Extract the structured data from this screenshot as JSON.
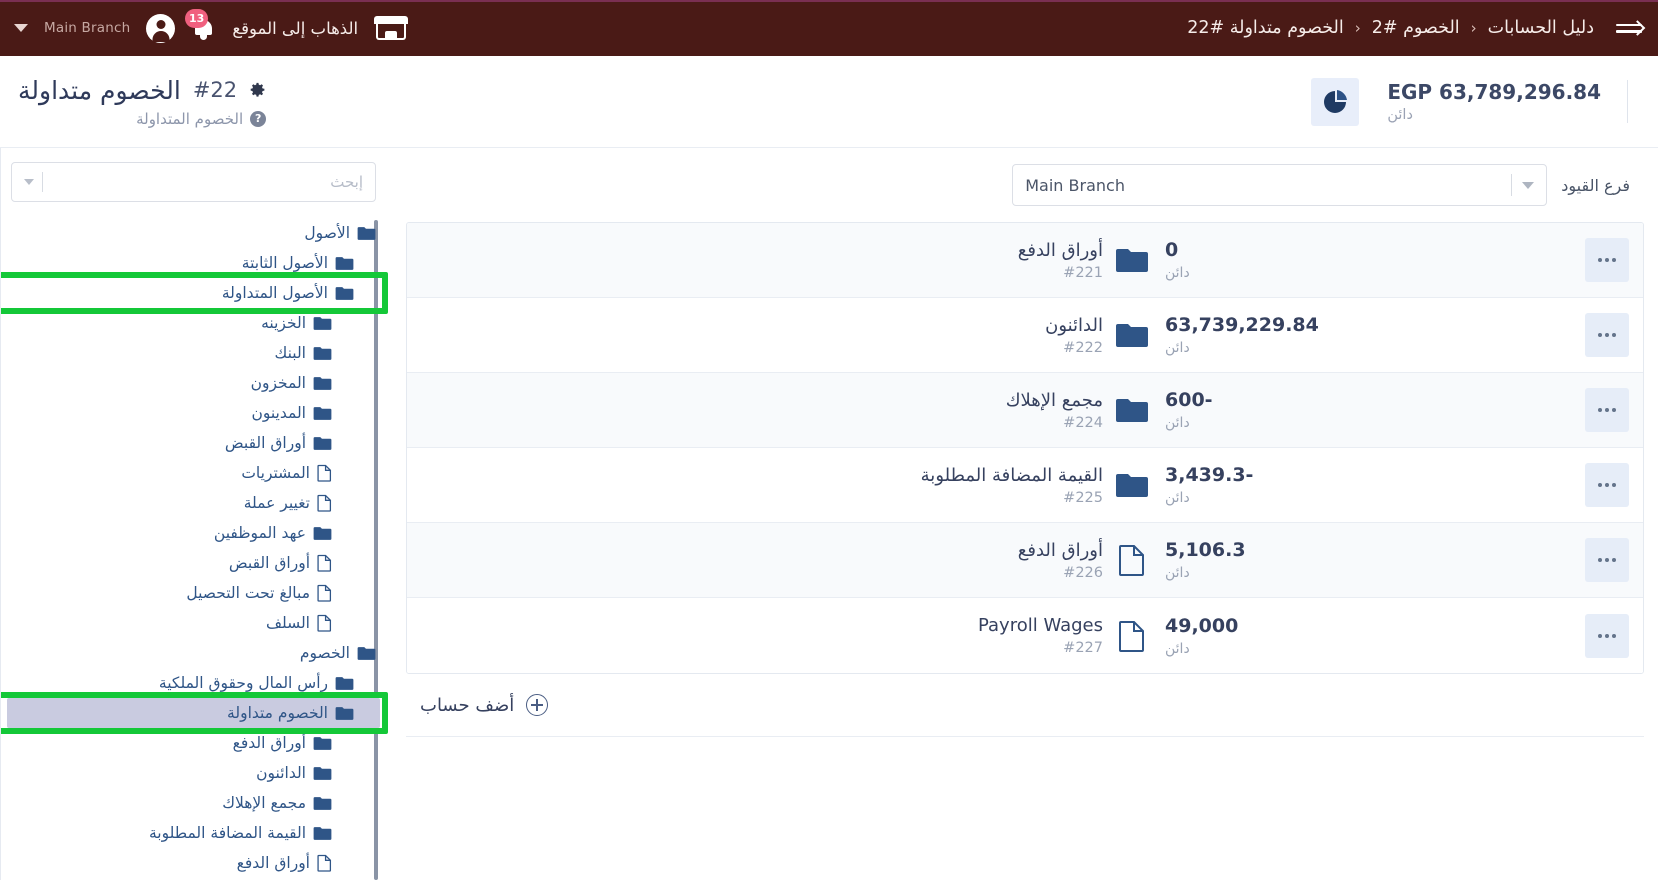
{
  "topbar": {
    "menu_icon": "hamburger-arrow-icon",
    "breadcrumb": [
      {
        "label": "دليل الحسابات"
      },
      {
        "label": "الخصوم #2"
      },
      {
        "label": "الخصوم متداولة #22"
      }
    ],
    "separator": "‹",
    "branch_label": "Main Branch",
    "branch_caret_icon": "chevron-down-icon",
    "avatar_icon": "user-avatar-icon",
    "bell_icon": "bell-icon",
    "notification_count": "13",
    "goto_site_label": "الذهاب إلى الموقع",
    "shop_icon": "storefront-icon"
  },
  "header": {
    "title": "الخصوم متداولة",
    "title_number": "#22",
    "gear_icon": "gear-icon",
    "subtitle": "الخصوم المتداولة",
    "help_icon": "help-circle-icon",
    "balance_icon": "pie-chart-icon",
    "balance_amount": "EGP 63,789,296.84",
    "balance_type": "دائن"
  },
  "filter": {
    "label": "فرع القيود",
    "selected_value": "Main Branch",
    "caret_icon": "chevron-down-icon"
  },
  "search": {
    "placeholder": "إبحث",
    "value": "",
    "caret_icon": "chevron-down-icon"
  },
  "accounts": [
    {
      "name": "أوراق الدفع",
      "code": "#221",
      "icon": "folder-icon",
      "amount": "0",
      "type": "دائن",
      "menu_icon": "ellipsis-icon"
    },
    {
      "name": "الدائنون",
      "code": "#222",
      "icon": "folder-icon",
      "amount": "63,739,229.84",
      "type": "دائن",
      "menu_icon": "ellipsis-icon"
    },
    {
      "name": "مجمع الإهلاك",
      "code": "#224",
      "icon": "folder-icon",
      "amount": "600-",
      "type": "دائن",
      "menu_icon": "ellipsis-icon"
    },
    {
      "name": "القيمة المضافة المطلوبة",
      "code": "#225",
      "icon": "folder-icon",
      "amount": "3,439.3-",
      "type": "دائن",
      "menu_icon": "ellipsis-icon"
    },
    {
      "name": "أوراق الدفع",
      "code": "#226",
      "icon": "file-icon",
      "amount": "5,106.3",
      "type": "دائن",
      "menu_icon": "ellipsis-icon"
    },
    {
      "name": "Payroll Wages",
      "code": "#227",
      "icon": "file-icon",
      "amount": "49,000",
      "type": "دائن",
      "menu_icon": "ellipsis-icon"
    }
  ],
  "add_account": {
    "label": "أضف حساب",
    "icon": "plus-circle-icon"
  },
  "tree": [
    {
      "label": "الأصول",
      "level": 1,
      "icon": "folder-icon",
      "selected": false,
      "highlighted": false
    },
    {
      "label": "الأصول الثابتة",
      "level": 2,
      "icon": "folder-icon",
      "selected": false,
      "highlighted": false
    },
    {
      "label": "الأصول المتداولة",
      "level": 2,
      "icon": "folder-icon",
      "selected": false,
      "highlighted": true
    },
    {
      "label": "الخزينه",
      "level": 3,
      "icon": "folder-icon",
      "selected": false,
      "highlighted": false
    },
    {
      "label": "البنك",
      "level": 3,
      "icon": "folder-icon",
      "selected": false,
      "highlighted": false
    },
    {
      "label": "المخزون",
      "level": 3,
      "icon": "folder-icon",
      "selected": false,
      "highlighted": false
    },
    {
      "label": "المدينون",
      "level": 3,
      "icon": "folder-icon",
      "selected": false,
      "highlighted": false
    },
    {
      "label": "أوراق القبض",
      "level": 3,
      "icon": "folder-icon",
      "selected": false,
      "highlighted": false
    },
    {
      "label": "المشتريات",
      "level": 3,
      "icon": "file-icon",
      "selected": false,
      "highlighted": false
    },
    {
      "label": "تغيير عملة",
      "level": 3,
      "icon": "file-icon",
      "selected": false,
      "highlighted": false
    },
    {
      "label": "عهد الموظفين",
      "level": 3,
      "icon": "folder-icon",
      "selected": false,
      "highlighted": false
    },
    {
      "label": "أوراق القبض",
      "level": 3,
      "icon": "file-icon",
      "selected": false,
      "highlighted": false
    },
    {
      "label": "مبالغ تحت التحصيل",
      "level": 3,
      "icon": "file-icon",
      "selected": false,
      "highlighted": false
    },
    {
      "label": "السلف",
      "level": 3,
      "icon": "file-icon",
      "selected": false,
      "highlighted": false
    },
    {
      "label": "الخصوم",
      "level": 1,
      "icon": "folder-icon",
      "selected": false,
      "highlighted": false
    },
    {
      "label": "رأس المال وحقوق الملكية",
      "level": 2,
      "icon": "folder-icon",
      "selected": false,
      "highlighted": false
    },
    {
      "label": "الخصوم متداولة",
      "level": 2,
      "icon": "folder-icon",
      "selected": true,
      "highlighted": true
    },
    {
      "label": "أوراق الدفع",
      "level": 3,
      "icon": "folder-icon",
      "selected": false,
      "highlighted": false
    },
    {
      "label": "الدائنون",
      "level": 3,
      "icon": "folder-icon",
      "selected": false,
      "highlighted": false
    },
    {
      "label": "مجمع الإهلاك",
      "level": 3,
      "icon": "folder-icon",
      "selected": false,
      "highlighted": false
    },
    {
      "label": "القيمة المضافة المطلوبة",
      "level": 3,
      "icon": "folder-icon",
      "selected": false,
      "highlighted": false
    },
    {
      "label": "أوراق الدفع",
      "level": 3,
      "icon": "file-icon",
      "selected": false,
      "highlighted": false
    }
  ],
  "colors": {
    "topbar_bg": "#4a1a16",
    "accent_tree": "#2f5587",
    "highlight_green": "#14c838",
    "selected_bg": "#c9cbe0",
    "badge_pink": "#f0607f"
  }
}
